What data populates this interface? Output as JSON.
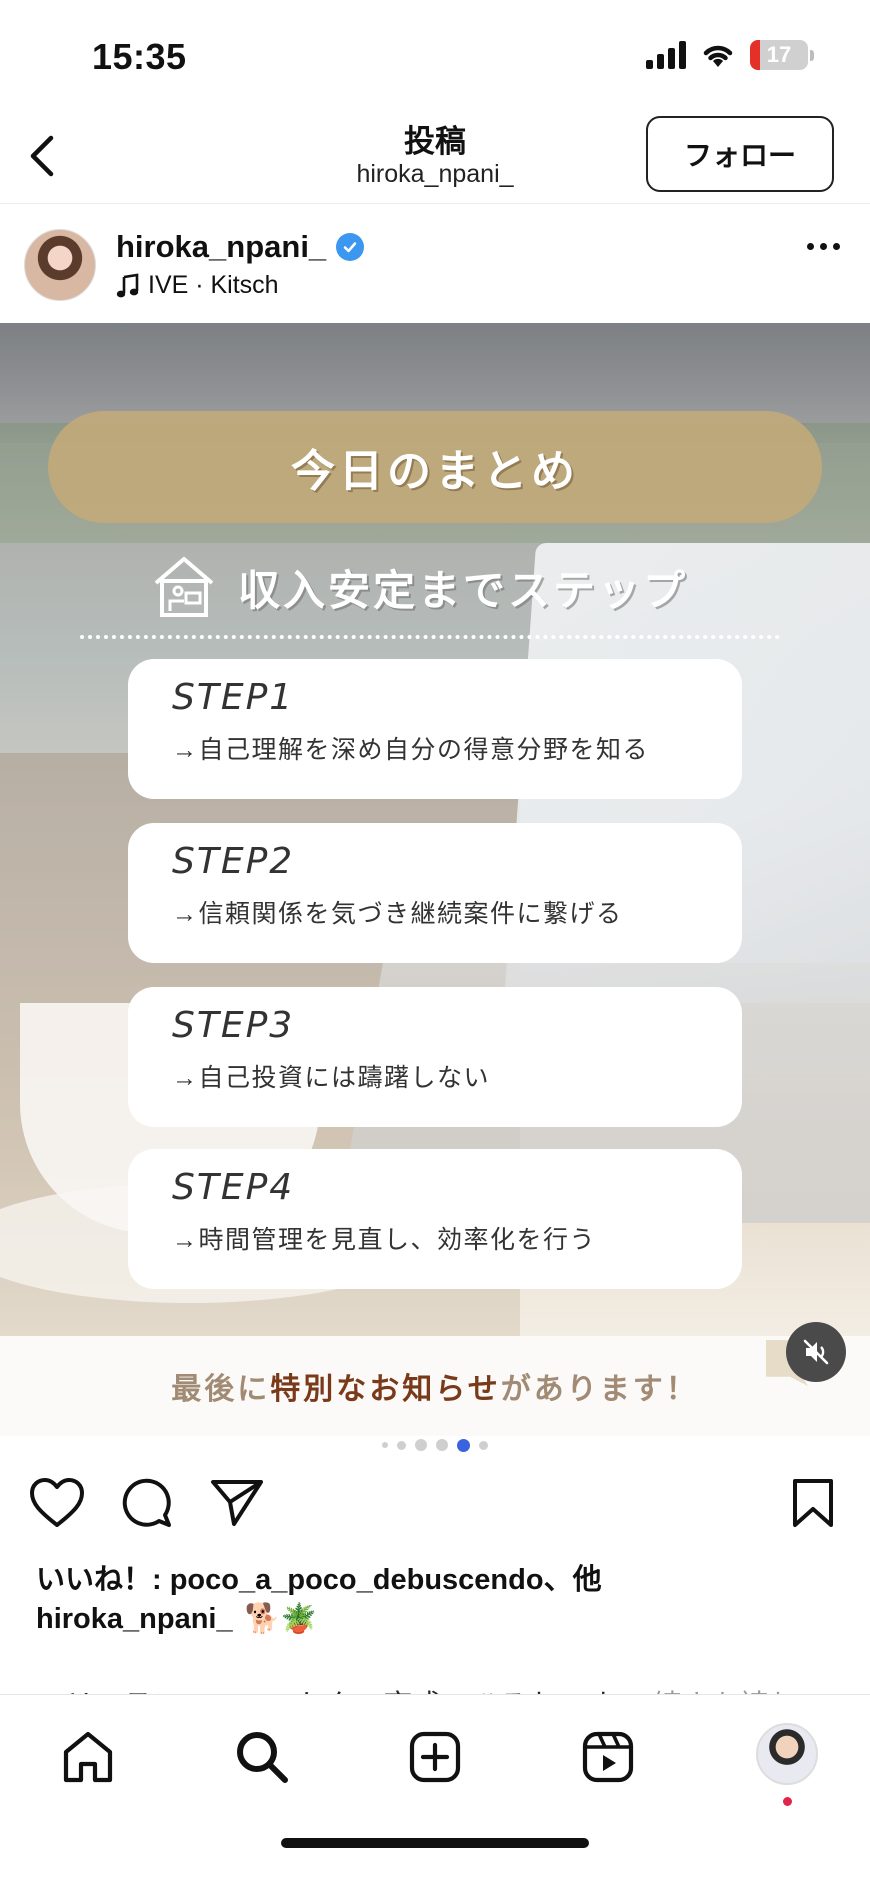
{
  "status_bar": {
    "time": "15:35",
    "battery": "17"
  },
  "header": {
    "title": "投稿",
    "subtitle": "hiroka_npani_",
    "follow_label": "フォロー"
  },
  "author": {
    "name": "hiroka_npani_",
    "music": "IVE · Kitsch"
  },
  "post": {
    "summary_title": "今日のまとめ",
    "step_heading": "収入安定までステップ",
    "steps": [
      {
        "label": "STEP1",
        "desc": "→自己理解を深め自分の得意分野を知る"
      },
      {
        "label": "STEP2",
        "desc": "→信頼関係を気づき継続案件に繋げる"
      },
      {
        "label": "STEP3",
        "desc": "→自己投資には躊躇しない"
      },
      {
        "label": "STEP4",
        "desc": "→時間管理を見直し、効率化を行う"
      }
    ],
    "notice_prefix": "最後に",
    "notice_strong": "特別なお知らせ",
    "notice_suffix": "があります！",
    "carousel": {
      "total": 6,
      "active_index": 4
    }
  },
  "engagement": {
    "likes_text": "いいね！: poco_a_poco_debuscendo、他",
    "caption_user": "hiroka_npani_",
    "caption_emoji": "🐕🪴",
    "caption_preview": "フリーランス・マーケター育成のひろおです… ",
    "caption_more": "続きを読む"
  },
  "icons": {
    "back": "chevron-left-icon",
    "verified": "verified-badge-icon",
    "music": "music-note-icon",
    "more": "more-dots-icon",
    "mute": "speaker-muted-icon",
    "like": "heart-icon",
    "comment": "comment-icon",
    "share": "send-icon",
    "save": "bookmark-icon",
    "home": "home-icon",
    "search": "search-icon",
    "create": "plus-square-icon",
    "reels": "reels-icon"
  },
  "colors": {
    "accent": "#3b97f0",
    "notification": "#e0244b",
    "battery_low": "#e5302a"
  }
}
